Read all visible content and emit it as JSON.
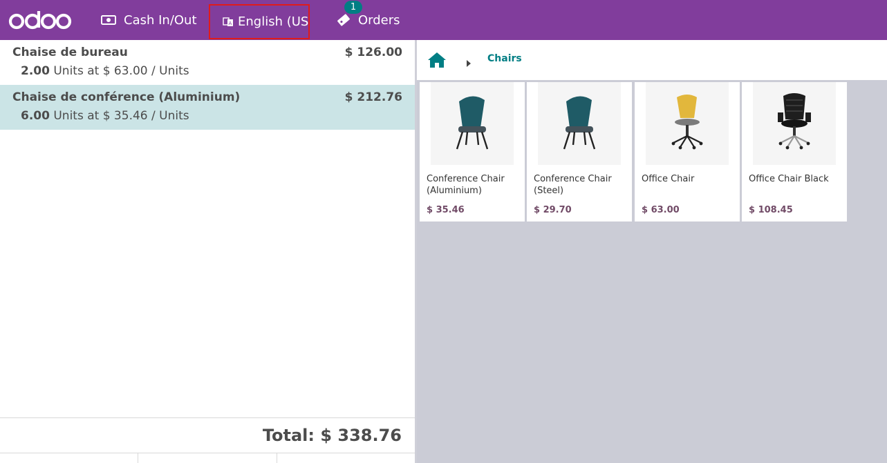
{
  "navbar": {
    "logo_text": "odoo",
    "cash_label": "Cash In/Out",
    "language_label": "English (US",
    "orders_label": "Orders",
    "orders_badge": "1",
    "background": "#813d9c",
    "highlight_color": "#e01b1b"
  },
  "order": {
    "lines": [
      {
        "name": "Chaise de bureau",
        "price": "$ 126.00",
        "qty": "2.00",
        "unit_text": "Units at $ 63.00 / Units"
      },
      {
        "name": "Chaise de conférence (Aluminium)",
        "price": "$ 212.76",
        "qty": "6.00",
        "unit_text": "Units at $ 35.46 / Units"
      }
    ],
    "total": "Total: $ 338.76"
  },
  "breadcrumb": {
    "category": "Chairs"
  },
  "products": [
    {
      "name": "Conference Chair (Aluminium)",
      "price": "$ 35.46",
      "image": "teal-chair"
    },
    {
      "name": "Conference Chair (Steel)",
      "price": "$ 29.70",
      "image": "teal-chair"
    },
    {
      "name": "Office Chair",
      "price": "$ 63.00",
      "image": "yellow-office-chair"
    },
    {
      "name": "Office Chair Black",
      "price": "$ 108.45",
      "image": "black-office-chair"
    }
  ],
  "colors": {
    "accent": "#017e84",
    "selected_line": "#cbe4e6",
    "price": "#714b67"
  }
}
